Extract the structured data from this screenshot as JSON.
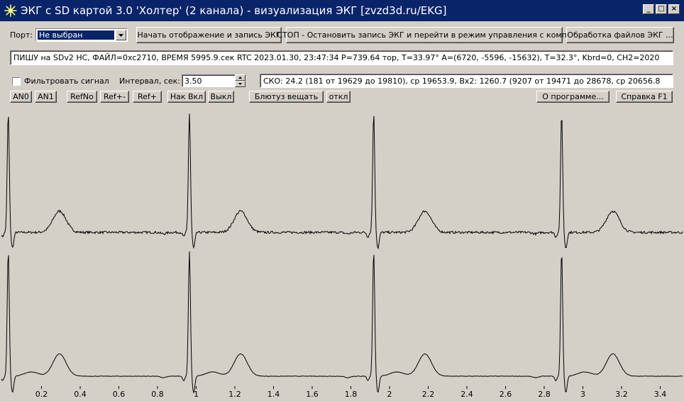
{
  "window": {
    "title": "ЭКГ с SD картой 3.0 'Холтер' (2 канала)  - визуализация ЭКГ [zvzd3d.ru/EKG]",
    "controls": [
      "_",
      "□",
      "×"
    ]
  },
  "toolbar1": {
    "port_label": "Порт:",
    "port_value": "Не выбран",
    "start_button": "Начать отображение и запись ЭКГ",
    "stop_button": "СТОП - Остановить запись ЭКГ и перейти в режим управления с компа",
    "process_button": "Обработка файлов ЭКГ ..."
  },
  "status_line": "ПИШУ на SDv2 HC, ФАЙЛ=0xc2710, ВРЕМЯ 5995.9.сек RTC 2023.01.30, 23:47:34 P=739.64 тор, T=33.97° A=(6720, -5596, -15632), T=32.3°, Kbrd=0, CH2=2020",
  "filter": {
    "checkbox_label": "Фильтровать сигнал",
    "checked": false,
    "interval_label": "Интервал, сек:",
    "interval_value": "3.50"
  },
  "stats_line": "СКО: 24.2 (181 от 19629 до 19810), ср 19653.9,   Вх2: 1260.7 (9207 от 19471 до 28678, ср 20656.8",
  "buttons2": {
    "an0": "AN0",
    "an1": "AN1",
    "refno": "RefNo",
    "refpm": "Ref+-",
    "refp": "Ref+",
    "nak_vkl": "Нак Вкл",
    "vykl": "Выкл",
    "bluetooth": "Блютуз вещать",
    "otkl": "откл",
    "about": "О программе...",
    "help": "Справка F1"
  },
  "chart_data": {
    "type": "line",
    "xlim": [
      0,
      3.5
    ],
    "x_ticks": [
      "0.2",
      "0.4",
      "0.6",
      "0.8",
      "1",
      "1.2",
      "1.4",
      "1.6",
      "1.8",
      "2",
      "2.2",
      "2.4",
      "2.6",
      "2.8",
      "3",
      "3.2",
      "3.4"
    ],
    "r_peak_times": [
      0.028,
      0.965,
      1.918,
      2.89
    ],
    "series": [
      {
        "channel": 1,
        "noisy": true
      },
      {
        "channel": 2,
        "noisy": false
      }
    ]
  },
  "colors": {
    "title_bg": "#0a246a",
    "face": "#d4d0c8",
    "trace": "#000000"
  },
  "icons": {
    "app": "sun-star-icon",
    "combo_arrow": "chevron-down-icon",
    "spin_up": "arrow-up-icon",
    "spin_down": "arrow-down-icon"
  }
}
